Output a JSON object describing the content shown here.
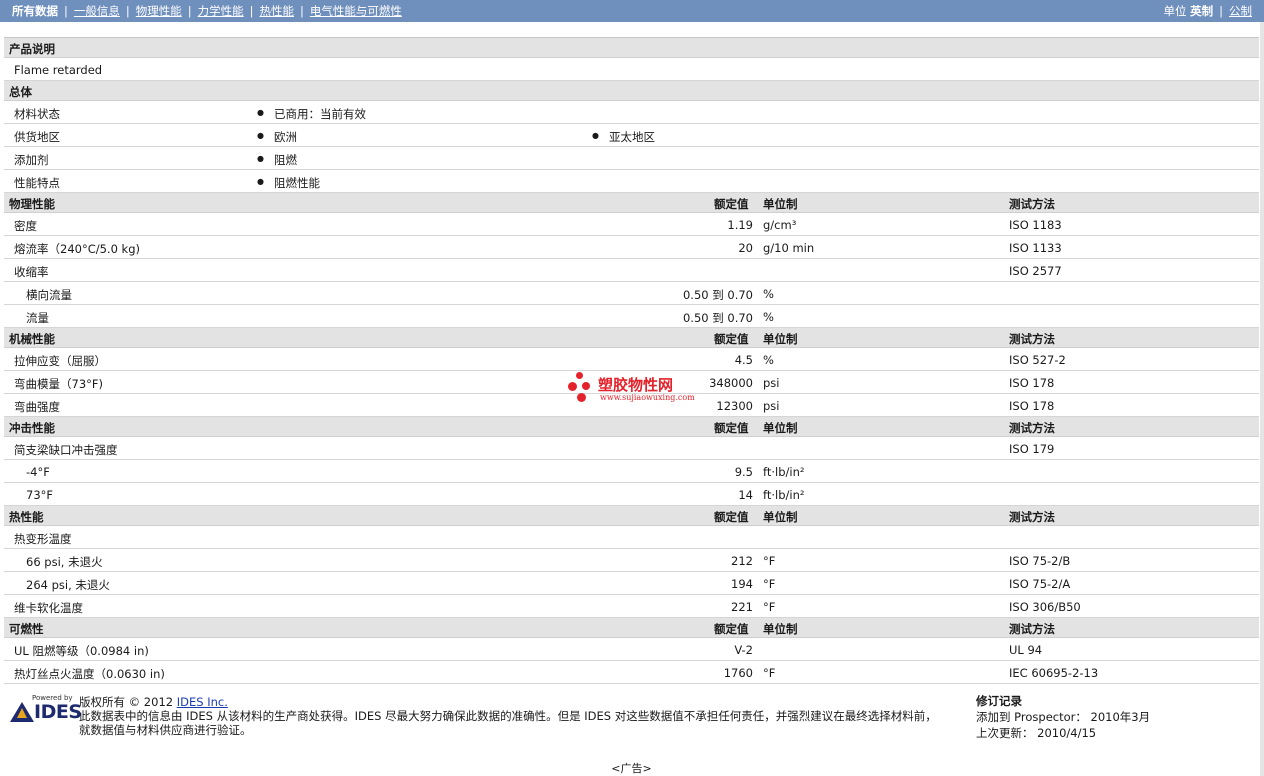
{
  "nav": {
    "all": "所有数据",
    "general": "一般信息",
    "physical": "物理性能",
    "mechanical": "力学性能",
    "thermal": "热性能",
    "electrical": "电气性能与可燃性",
    "units_label": "单位",
    "units_english": "英制",
    "units_metric": "公制"
  },
  "sections": {
    "desc": {
      "title": "产品说明",
      "text": "Flame retarded"
    },
    "general": {
      "title": "总体",
      "rows": [
        {
          "label": "材料状态",
          "b1": "已商用：当前有效",
          "b2": ""
        },
        {
          "label": "供货地区",
          "b1": "欧洲",
          "b2": "亚太地区"
        },
        {
          "label": "添加剂",
          "b1": "阻燃",
          "b2": ""
        },
        {
          "label": "性能特点",
          "b1": "阻燃性能",
          "b2": ""
        }
      ]
    },
    "physical": {
      "title": "物理性能",
      "rows": [
        {
          "label": "密度",
          "value": "1.19",
          "unit": "g/cm³",
          "method": "ISO 1183",
          "sub": false
        },
        {
          "label": "熔流率（240°C/5.0 kg)",
          "value": "20",
          "unit": "g/10 min",
          "method": "ISO 1133",
          "sub": false
        },
        {
          "label": "收缩率",
          "value": "",
          "unit": "",
          "method": "ISO 2577",
          "sub": false
        },
        {
          "label": "横向流量",
          "value": "0.50 到  0.70",
          "unit": "%",
          "method": "",
          "sub": true
        },
        {
          "label": "流量",
          "value": "0.50 到  0.70",
          "unit": "%",
          "method": "",
          "sub": true
        }
      ]
    },
    "mechanical": {
      "title": "机械性能",
      "rows": [
        {
          "label": "拉伸应变（屈服）",
          "value": "4.5",
          "unit": "%",
          "method": "ISO 527-2",
          "sub": false
        },
        {
          "label": "弯曲模量（73°F)",
          "value": "348000",
          "unit": "psi",
          "method": "ISO 178",
          "sub": false
        },
        {
          "label": "弯曲强度",
          "value": "12300",
          "unit": "psi",
          "method": "ISO 178",
          "sub": false
        }
      ]
    },
    "impact": {
      "title": "冲击性能",
      "rows": [
        {
          "label": "简支梁缺口冲击强度",
          "value": "",
          "unit": "",
          "method": "ISO 179",
          "sub": false
        },
        {
          "label": "-4°F",
          "value": "9.5",
          "unit": "ft·lb/in²",
          "method": "",
          "sub": true
        },
        {
          "label": "73°F",
          "value": "14",
          "unit": "ft·lb/in²",
          "method": "",
          "sub": true
        }
      ]
    },
    "thermal": {
      "title": "热性能",
      "rows": [
        {
          "label": "热变形温度",
          "value": "",
          "unit": "",
          "method": "",
          "sub": false
        },
        {
          "label": "66 psi, 未退火",
          "value": "212",
          "unit": "°F",
          "method": "ISO 75-2/B",
          "sub": true
        },
        {
          "label": "264 psi, 未退火",
          "value": "194",
          "unit": "°F",
          "method": "ISO 75-2/A",
          "sub": true
        },
        {
          "label": "维卡软化温度",
          "value": "221",
          "unit": "°F",
          "method": "ISO 306/B50",
          "sub": false
        }
      ]
    },
    "flammability": {
      "title": "可燃性",
      "rows": [
        {
          "label": "UL 阻燃等级（0.0984 in)",
          "value": "V-2",
          "unit": "",
          "method": "UL 94",
          "sub": false
        },
        {
          "label": "热灯丝点火温度（0.0630 in)",
          "value": "1760",
          "unit": "°F",
          "method": "IEC 60695-2-13",
          "sub": false
        }
      ]
    }
  },
  "col_headers": {
    "value": "额定值",
    "unit": "单位制",
    "method": "测试方法"
  },
  "footer": {
    "powered_by": "Powered by",
    "logo_text": "IDES",
    "copyright": "版权所有 © 2012",
    "company_link": "IDES Inc.",
    "disclaimer_1": "此数据表中的信息由  IDES 从该材料的生产商处获得。IDES 尽最大努力确保此数据的准确性。但是  IDES 对这些数据值不承担任何责任，并强烈建议在最终选择材料前，",
    "disclaimer_2": "就数据值与材料供应商进行验证。",
    "rev_title": "修订记录",
    "rev_added": "添加到  Prospector：  2010年3月",
    "rev_updated": "上次更新：   2010/4/15",
    "ad": "<广告>"
  },
  "watermark": {
    "cn": "塑胶物性网",
    "url": "www.sujiaowuxing.com"
  },
  "colors": {
    "topbar": "#6f8fbd",
    "section_head": "#e3e3e3",
    "brand_red": "#e4222b",
    "ides_navy": "#1e2a6e"
  }
}
